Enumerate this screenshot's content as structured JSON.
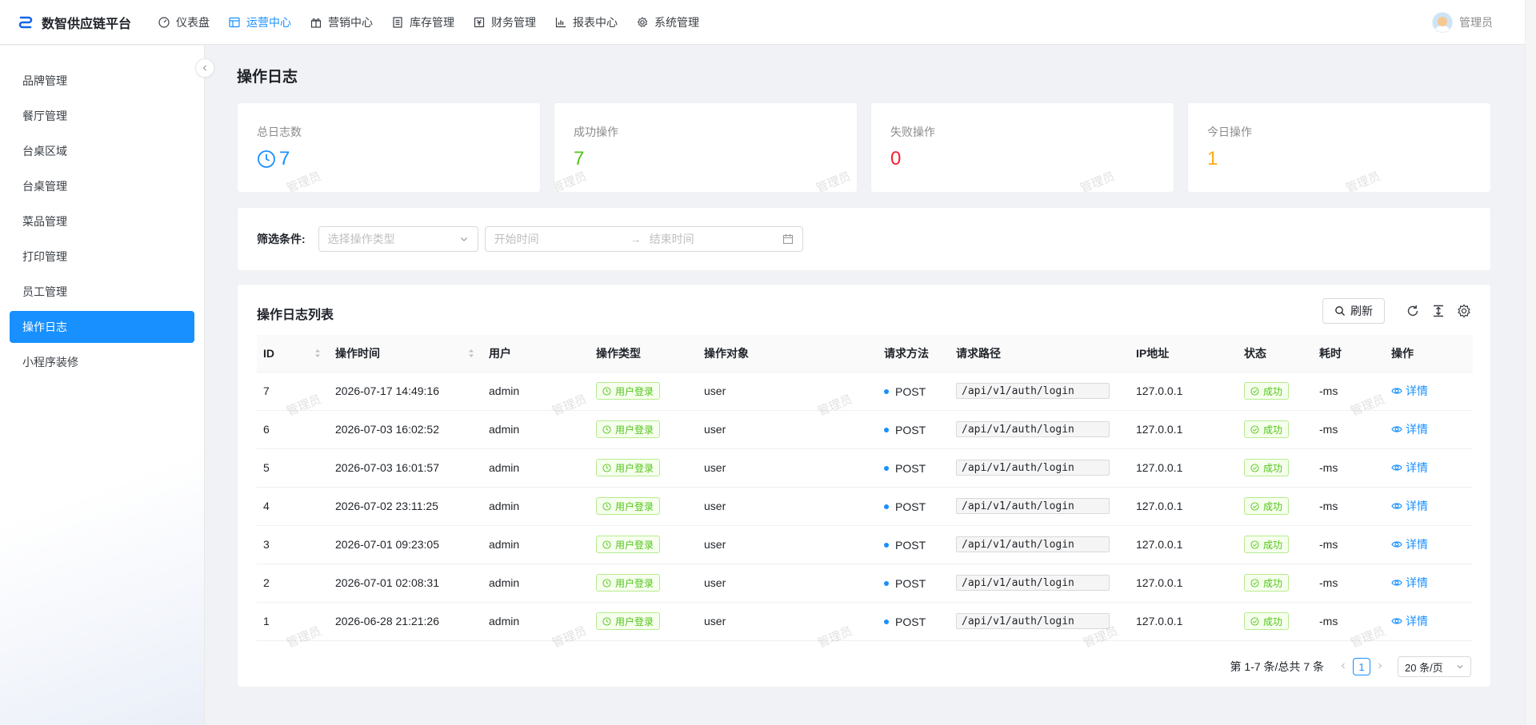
{
  "header": {
    "app_title": "数智供应链平台",
    "nav": [
      {
        "label": "仪表盘",
        "icon": "dashboard-icon",
        "active": false
      },
      {
        "label": "运营中心",
        "icon": "operations-icon",
        "active": true
      },
      {
        "label": "营销中心",
        "icon": "gift-icon",
        "active": false
      },
      {
        "label": "库存管理",
        "icon": "inventory-icon",
        "active": false
      },
      {
        "label": "财务管理",
        "icon": "finance-icon",
        "active": false
      },
      {
        "label": "报表中心",
        "icon": "chart-icon",
        "active": false
      },
      {
        "label": "系统管理",
        "icon": "gear-icon",
        "active": false
      }
    ],
    "user_name": "管理员"
  },
  "sidebar": {
    "items": [
      {
        "label": "品牌管理"
      },
      {
        "label": "餐厅管理"
      },
      {
        "label": "台桌区域"
      },
      {
        "label": "台桌管理"
      },
      {
        "label": "菜品管理"
      },
      {
        "label": "打印管理"
      },
      {
        "label": "员工管理"
      },
      {
        "label": "操作日志",
        "active": true
      },
      {
        "label": "小程序装修"
      }
    ]
  },
  "page": {
    "title": "操作日志",
    "watermark": "管理员"
  },
  "stats": [
    {
      "label": "总日志数",
      "value": "7",
      "color": "#1890ff",
      "icon": "clock-icon"
    },
    {
      "label": "成功操作",
      "value": "7",
      "color": "#52c41a"
    },
    {
      "label": "失败操作",
      "value": "0",
      "color": "#f5222d"
    },
    {
      "label": "今日操作",
      "value": "1",
      "color": "#faad14"
    }
  ],
  "filter": {
    "label": "筛选条件:",
    "type_placeholder": "选择操作类型",
    "start_placeholder": "开始时间",
    "end_placeholder": "结束时间"
  },
  "table": {
    "title": "操作日志列表",
    "refresh_label": "刷新",
    "columns": [
      "ID",
      "操作时间",
      "用户",
      "操作类型",
      "操作对象",
      "请求方法",
      "请求路径",
      "IP地址",
      "状态",
      "耗时",
      "操作"
    ],
    "rows": [
      {
        "id": "7",
        "time": "2026-07-17 14:49:16",
        "user": "admin",
        "type": "用户登录",
        "object": "user",
        "method": "POST",
        "path": "/api/v1/auth/login",
        "ip": "127.0.0.1",
        "status": "成功",
        "duration": "-ms",
        "action": "详情"
      },
      {
        "id": "6",
        "time": "2026-07-03 16:02:52",
        "user": "admin",
        "type": "用户登录",
        "object": "user",
        "method": "POST",
        "path": "/api/v1/auth/login",
        "ip": "127.0.0.1",
        "status": "成功",
        "duration": "-ms",
        "action": "详情"
      },
      {
        "id": "5",
        "time": "2026-07-03 16:01:57",
        "user": "admin",
        "type": "用户登录",
        "object": "user",
        "method": "POST",
        "path": "/api/v1/auth/login",
        "ip": "127.0.0.1",
        "status": "成功",
        "duration": "-ms",
        "action": "详情"
      },
      {
        "id": "4",
        "time": "2026-07-02 23:11:25",
        "user": "admin",
        "type": "用户登录",
        "object": "user",
        "method": "POST",
        "path": "/api/v1/auth/login",
        "ip": "127.0.0.1",
        "status": "成功",
        "duration": "-ms",
        "action": "详情"
      },
      {
        "id": "3",
        "time": "2026-07-01 09:23:05",
        "user": "admin",
        "type": "用户登录",
        "object": "user",
        "method": "POST",
        "path": "/api/v1/auth/login",
        "ip": "127.0.0.1",
        "status": "成功",
        "duration": "-ms",
        "action": "详情"
      },
      {
        "id": "2",
        "time": "2026-07-01 02:08:31",
        "user": "admin",
        "type": "用户登录",
        "object": "user",
        "method": "POST",
        "path": "/api/v1/auth/login",
        "ip": "127.0.0.1",
        "status": "成功",
        "duration": "-ms",
        "action": "详情"
      },
      {
        "id": "1",
        "time": "2026-06-28 21:21:26",
        "user": "admin",
        "type": "用户登录",
        "object": "user",
        "method": "POST",
        "path": "/api/v1/auth/login",
        "ip": "127.0.0.1",
        "status": "成功",
        "duration": "-ms",
        "action": "详情"
      }
    ]
  },
  "pagination": {
    "summary": "第 1-7 条/总共 7 条",
    "current_page": "1",
    "page_size": "20 条/页"
  }
}
